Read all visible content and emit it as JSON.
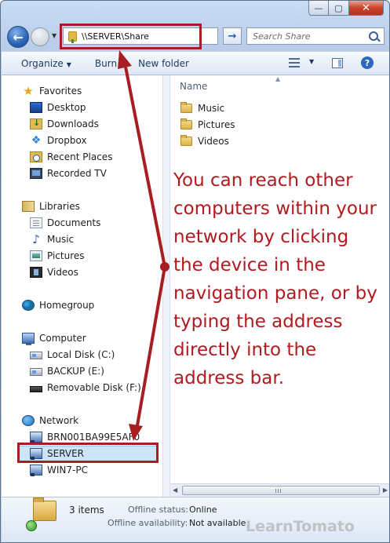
{
  "window": {
    "minimize_glyph": "—",
    "maximize_glyph": "▢",
    "close_glyph": "✕"
  },
  "navbar": {
    "back_glyph": "←",
    "address": "\\\\SERVER\\Share",
    "go_glyph": "→",
    "search_placeholder": "Search Share"
  },
  "toolbar": {
    "organize_label": "Organize",
    "burn_label": "Burn",
    "new_folder_label": "New folder",
    "help_label": "?"
  },
  "sidebar": {
    "favorites": {
      "title": "Favorites",
      "items": [
        {
          "label": "Desktop",
          "icon": "desktop-icon"
        },
        {
          "label": "Downloads",
          "icon": "downloads-icon"
        },
        {
          "label": "Dropbox",
          "icon": "dropbox-icon"
        },
        {
          "label": "Recent Places",
          "icon": "recent-places-icon"
        },
        {
          "label": "Recorded TV",
          "icon": "recorded-tv-icon"
        }
      ]
    },
    "libraries": {
      "title": "Libraries",
      "items": [
        {
          "label": "Documents",
          "icon": "documents-icon"
        },
        {
          "label": "Music",
          "icon": "music-icon"
        },
        {
          "label": "Pictures",
          "icon": "pictures-icon"
        },
        {
          "label": "Videos",
          "icon": "videos-icon"
        }
      ]
    },
    "homegroup": {
      "title": "Homegroup"
    },
    "computer": {
      "title": "Computer",
      "items": [
        {
          "label": "Local Disk (C:)",
          "icon": "disk-icon"
        },
        {
          "label": "BACKUP (E:)",
          "icon": "disk-icon"
        },
        {
          "label": "Removable Disk (F:)",
          "icon": "removable-disk-icon"
        }
      ]
    },
    "network": {
      "title": "Network",
      "items": [
        {
          "label": "BRN001BA99E5AF0",
          "icon": "network-computer-icon"
        },
        {
          "label": "SERVER",
          "icon": "network-computer-icon",
          "selected": true
        },
        {
          "label": "WIN7-PC",
          "icon": "network-computer-icon"
        }
      ]
    }
  },
  "content": {
    "column_header": "Name",
    "files": [
      {
        "name": "Music",
        "type": "folder"
      },
      {
        "name": "Pictures",
        "type": "folder"
      },
      {
        "name": "Videos",
        "type": "folder"
      }
    ]
  },
  "details": {
    "item_count": "3 items",
    "offline_status_label": "Offline status:",
    "offline_status_value": "Online",
    "offline_availability_label": "Offline availability:",
    "offline_availability_value": "Not available"
  },
  "annotation": {
    "callout_text": "You can reach other computers within your network by clicking the device in the navigation pane, or by typing the address directly into the address bar.",
    "accent_color": "#a81d22"
  },
  "watermark": {
    "text": "LearnTomato"
  }
}
